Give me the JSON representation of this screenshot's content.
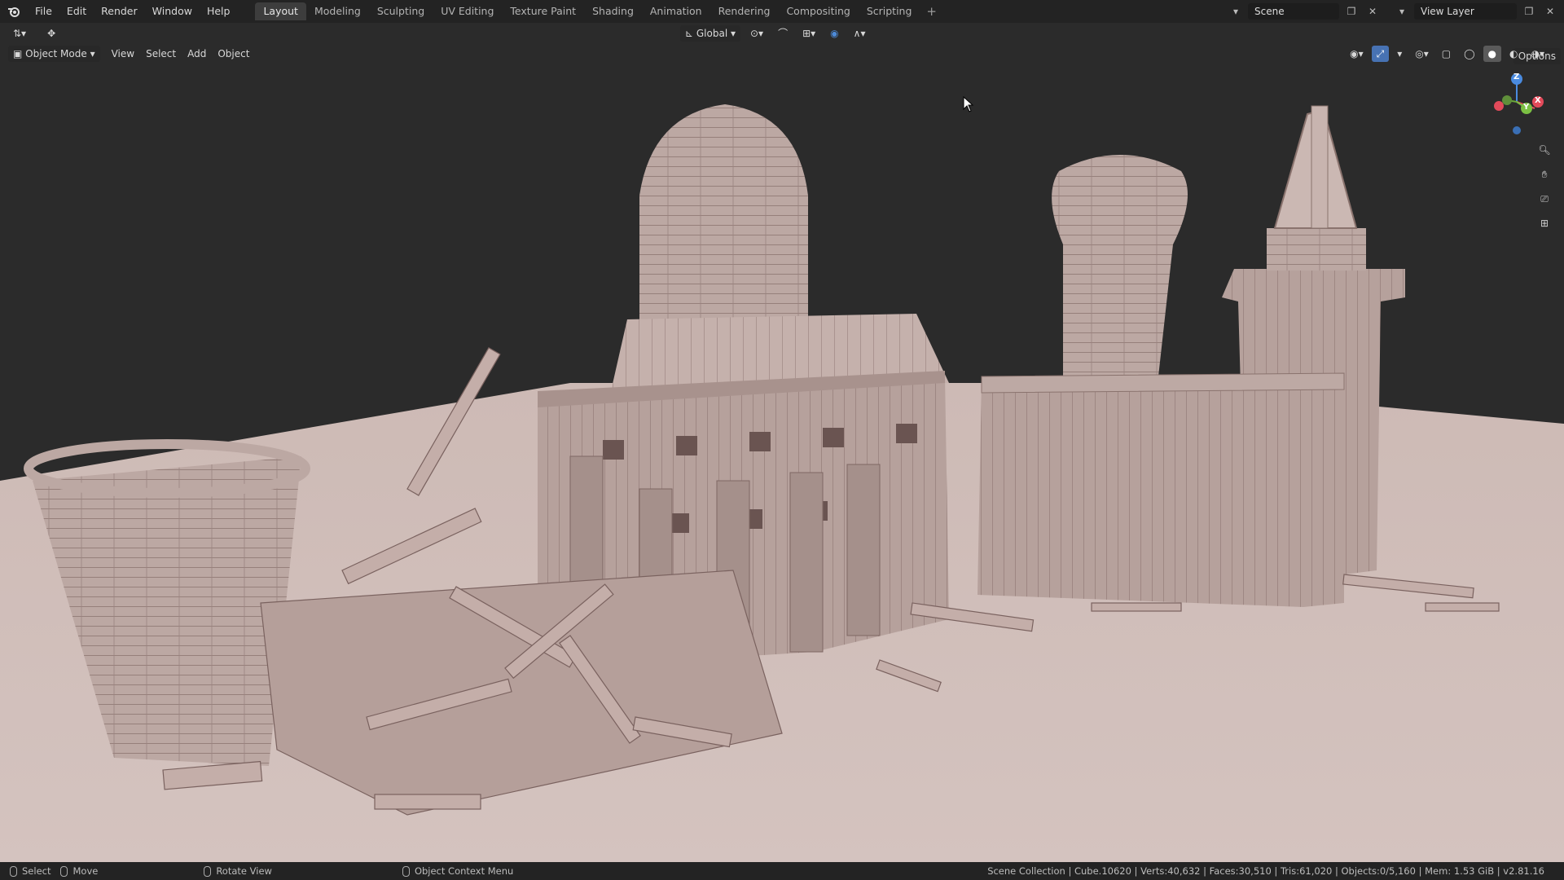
{
  "menu": [
    "File",
    "Edit",
    "Render",
    "Window",
    "Help"
  ],
  "workspaces": [
    "Layout",
    "Modeling",
    "Sculpting",
    "UV Editing",
    "Texture Paint",
    "Shading",
    "Animation",
    "Rendering",
    "Compositing",
    "Scripting"
  ],
  "active_workspace": "Layout",
  "scene": {
    "label": "Scene"
  },
  "view_layer": {
    "label": "View Layer"
  },
  "viewport_header": {
    "transform_orientation": "Global",
    "options": "Options"
  },
  "viewport_header2": {
    "mode": "Object Mode",
    "menus": [
      "View",
      "Select",
      "Add",
      "Object"
    ]
  },
  "gizmo": {
    "x": "X",
    "y": "Y",
    "z": "Z"
  },
  "statusbar": {
    "select": "Select",
    "move": "Move",
    "rotate": "Rotate View",
    "context": "Object Context Menu",
    "stats": "Scene Collection | Cube.10620 | Verts:40,632 | Faces:30,510 | Tris:61,020 | Objects:0/5,160 | Mem: 1.53 GiB | v2.81.16"
  },
  "colors": {
    "background": "#2b2b2b",
    "ground": "#c9b7b2",
    "planks": "#b9a39e",
    "plank_shadow": "#7d6460",
    "accent_blue": "#4772b3"
  }
}
